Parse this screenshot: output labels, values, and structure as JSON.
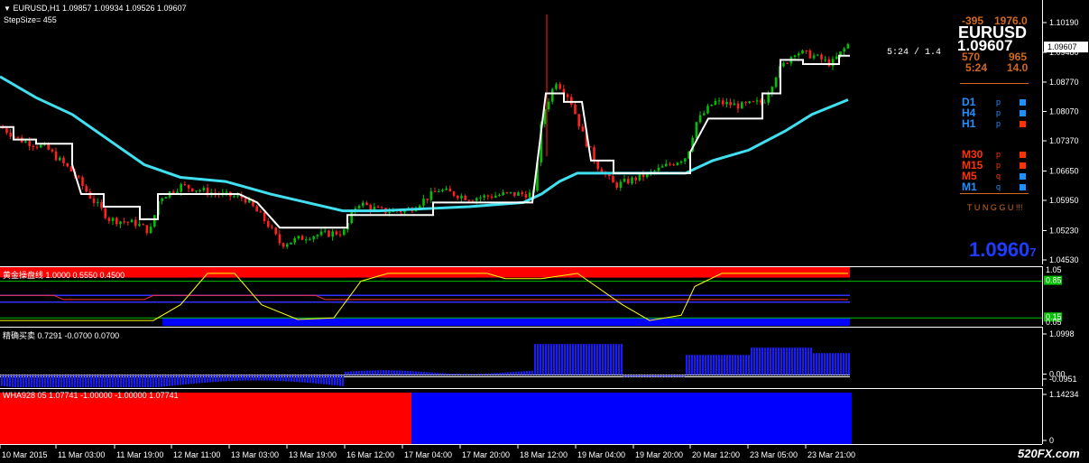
{
  "chart_header": {
    "symbol_line": "EURUSD,H1  1.09857 1.09934 1.09526 1.09607",
    "stepsize": "StepSize= 455",
    "countdown": "5:24 / 1.4"
  },
  "info_panel": {
    "row1_left": "-395",
    "row1_right": "1976.0",
    "symbol": "EURUSD",
    "price": "1.09607",
    "row3_left": "570",
    "row3_right": "965",
    "row4_left": "5:24",
    "row4_right": "14.0",
    "timeframes": [
      {
        "label": "D1",
        "flag": "p",
        "color": "#1e90ff",
        "box": "#1e90ff"
      },
      {
        "label": "H4",
        "flag": "p",
        "color": "#1e90ff",
        "box": "#1e90ff"
      },
      {
        "label": "H1",
        "flag": "p",
        "color": "#1e90ff",
        "box": "#ff3300"
      },
      {
        "label": "M30",
        "flag": "p",
        "color": "#ff3300",
        "box": "#ff3300"
      },
      {
        "label": "M15",
        "flag": "p",
        "color": "#ff3300",
        "box": "#ff3300"
      },
      {
        "label": "M5",
        "flag": "q",
        "color": "#ff3300",
        "box": "#1e90ff"
      },
      {
        "label": "M1",
        "flag": "q",
        "color": "#1e90ff",
        "box": "#1e90ff"
      }
    ],
    "status": "T U N G G U !!!",
    "big_price": "1.0960",
    "big_price_sub": "7"
  },
  "price_axis": {
    "labels": [
      "1.10190",
      "1.09480",
      "1.08770",
      "1.08070",
      "1.07370",
      "1.06650",
      "1.05950",
      "1.05230",
      "1.04530"
    ],
    "current": "1.09607"
  },
  "indicator1": {
    "title": "黄金操盘线 1.0000 0.5550 0.4500",
    "axis_labels": [
      "1.05",
      "0.85",
      "0.15",
      "0.05"
    ]
  },
  "indicator2": {
    "title": "精确买卖 0.7291 -0.0700 0.0700",
    "axis_labels": [
      "1.0998",
      "0.00",
      "-0.0951"
    ]
  },
  "indicator3": {
    "title": "WHA928 05 1.07741 -1.00000 -1.00000 1.07741",
    "axis_labels": [
      "1.14234",
      "0"
    ]
  },
  "time_axis": {
    "labels": [
      "10 Mar 2015",
      "11 Mar 03:00",
      "11 Mar 19:00",
      "12 Mar 11:00",
      "13 Mar 03:00",
      "13 Mar 19:00",
      "16 Mar 12:00",
      "17 Mar 04:00",
      "17 Mar 20:00",
      "18 Mar 12:00",
      "19 Mar 04:00",
      "19 Mar 20:00",
      "20 Mar 12:00",
      "23 Mar 05:00",
      "23 Mar 21:00"
    ]
  },
  "watermark": "520FX.com",
  "colors": {
    "bull": "#00c000",
    "bear": "#ff2020",
    "ma": "#40e0f0",
    "step": "#ffffff",
    "ind_red": "#ff0000",
    "ind_blue": "#0000ff",
    "ind_line": "#ffff00"
  }
}
